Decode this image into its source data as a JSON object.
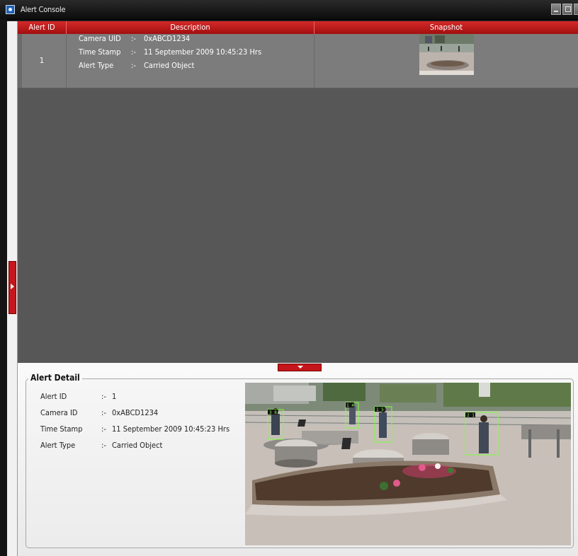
{
  "window": {
    "title": "Alert Console"
  },
  "table": {
    "headers": {
      "alert_id": "Alert ID",
      "description": "Description",
      "snapshot": "Snapshot"
    },
    "rows": [
      {
        "alert_id": "1",
        "fields": [
          {
            "key": "Camera UID",
            "sep": ":-",
            "value": "0xABCD1234"
          },
          {
            "key": "Time Stamp",
            "sep": ":-",
            "value": "11 September 2009 10:45:23 Hrs"
          },
          {
            "key": "Alert Type",
            "sep": ":-",
            "value": "Carried Object"
          }
        ]
      }
    ]
  },
  "detail": {
    "legend": "Alert Detail",
    "fields": [
      {
        "key": "Alert ID",
        "sep": ":-",
        "value": "1"
      },
      {
        "key": "Camera ID",
        "sep": ":-",
        "value": "0xABCD1234"
      },
      {
        "key": "Time Stamp",
        "sep": ":-",
        "value": "11 September 2009 10:45:23 Hrs"
      },
      {
        "key": "Alert Type",
        "sep": ":-",
        "value": "Carried Object"
      }
    ],
    "box_labels": [
      "3 8",
      "1 4",
      "1 5",
      "2 1"
    ]
  },
  "colors": {
    "accent": "#c4161c",
    "table_bg": "#575757",
    "row_bg": "#7c7c7c",
    "detection_box": "#7cff3a"
  },
  "icons": {
    "app": "camera-app-icon",
    "side_toggle": "chevron-right-icon",
    "detail_toggle": "chevron-down-icon"
  }
}
